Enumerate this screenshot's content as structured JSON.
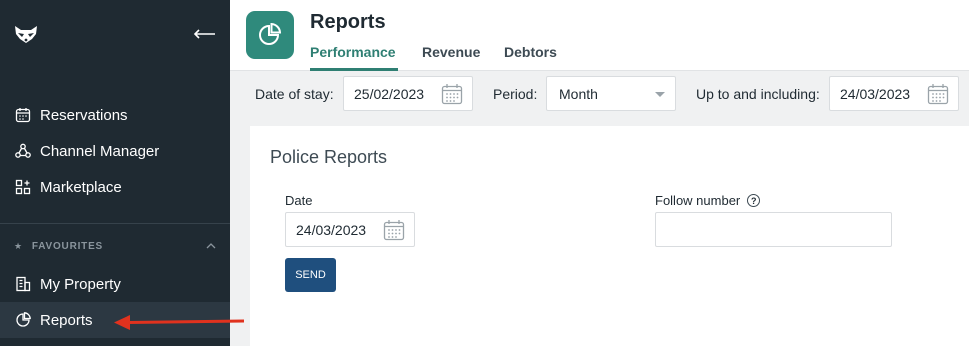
{
  "sidebar": {
    "nav_items": [
      {
        "label": "Reservations",
        "icon": "calendar-icon"
      },
      {
        "label": "Channel Manager",
        "icon": "channel-icon"
      },
      {
        "label": "Marketplace",
        "icon": "marketplace-icon"
      }
    ],
    "favourites_label": "FAVOURITES",
    "favourites": [
      {
        "label": "My Property",
        "icon": "building-icon"
      },
      {
        "label": "Reports",
        "icon": "pie-chart-icon",
        "active": true
      }
    ]
  },
  "header": {
    "title": "Reports",
    "tabs": [
      {
        "label": "Performance",
        "active": true
      },
      {
        "label": "Revenue"
      },
      {
        "label": "Debtors"
      }
    ]
  },
  "filters": {
    "date_of_stay_label": "Date of stay:",
    "date_of_stay_value": "25/02/2023",
    "period_label": "Period:",
    "period_value": "Month",
    "up_to_label": "Up to and including:",
    "up_to_value": "24/03/2023"
  },
  "police_reports": {
    "title": "Police Reports",
    "date_label": "Date",
    "date_value": "24/03/2023",
    "follow_number_label": "Follow number",
    "follow_number_value": "",
    "send_label": "SEND"
  },
  "colors": {
    "sidebar_bg": "#1f2a32",
    "accent": "#2f7f73",
    "send_button": "#1f4f7e",
    "annotation_arrow": "#e0321e"
  }
}
